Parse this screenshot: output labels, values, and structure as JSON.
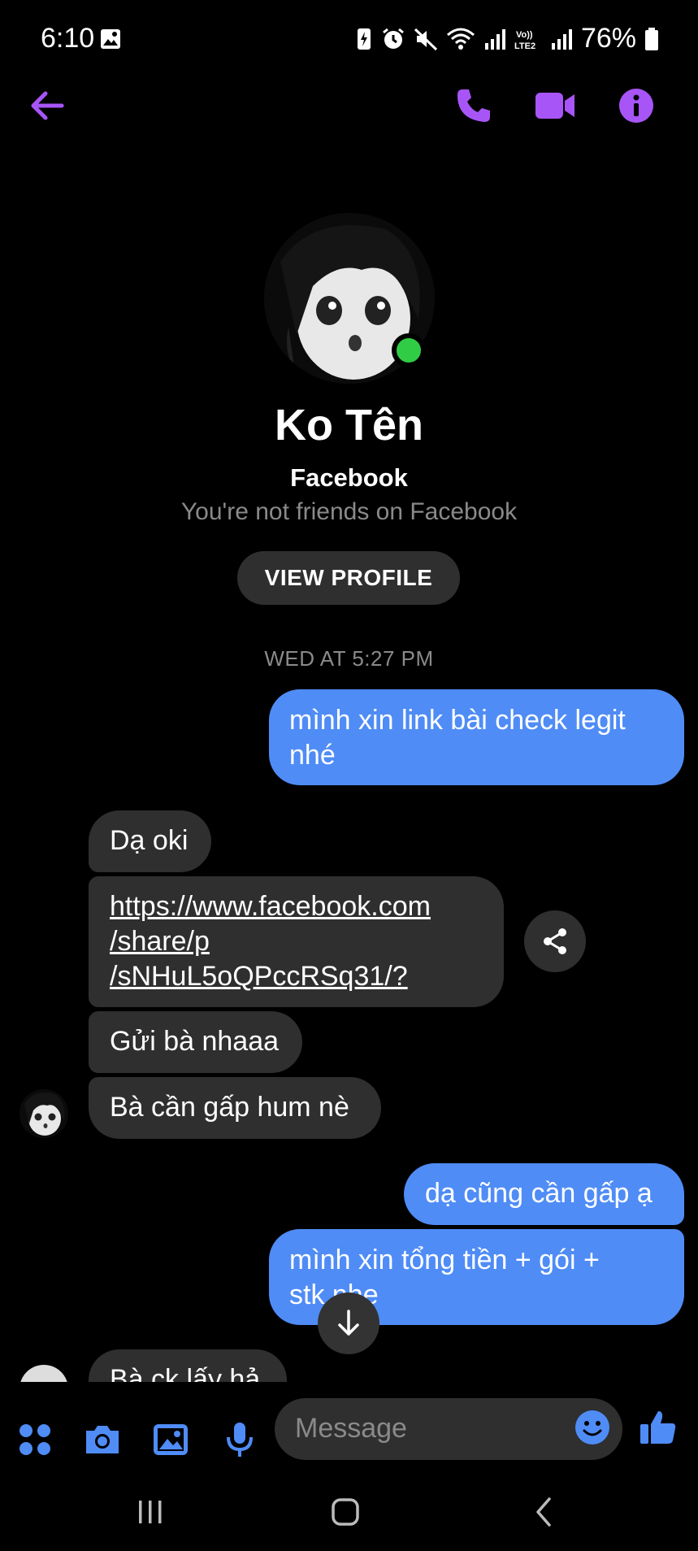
{
  "status_bar": {
    "time": "6:10",
    "battery": "76%"
  },
  "header": {
    "icons": [
      "back-arrow-icon",
      "phone-icon",
      "video-icon",
      "info-icon"
    ],
    "accent_color": "#a855f7"
  },
  "profile": {
    "name": "Ko Tên",
    "platform": "Facebook",
    "relation": "You're not friends on Facebook",
    "view_profile_label": "VIEW PROFILE"
  },
  "conversation": {
    "timestamp": "WED AT 5:27 PM",
    "messages": [
      {
        "from": "me",
        "lines": [
          "mình xin link bài check legit",
          "nhé"
        ]
      },
      {
        "from": "them",
        "lines": [
          "Dạ oki"
        ]
      },
      {
        "from": "them",
        "type": "link",
        "lines": [
          "https://www.facebook.com",
          "/share/p",
          "/sNHuL5oQPccRSq31/?"
        ]
      },
      {
        "from": "them",
        "lines": [
          "Gửi bà nhaaa"
        ]
      },
      {
        "from": "them",
        "lines": [
          "Bà cần gấp hum nè"
        ]
      },
      {
        "from": "me",
        "lines": [
          "dạ cũng cần gấp ạ"
        ]
      },
      {
        "from": "me",
        "lines": [
          "mình xin tổng tiền + gói +",
          "stk nhe"
        ]
      },
      {
        "from": "them",
        "lines": [
          "Bà ck lấy hả"
        ]
      }
    ]
  },
  "composer": {
    "placeholder": "Message",
    "icons": [
      "apps-icon",
      "camera-icon",
      "gallery-icon",
      "microphone-icon",
      "emoji-icon",
      "like-icon"
    ],
    "accent_color": "#4f8cf6"
  },
  "colors": {
    "outgoing_bubble": "#4f8cf6",
    "incoming_bubble": "#2f2f2f",
    "online": "#31cc46"
  }
}
